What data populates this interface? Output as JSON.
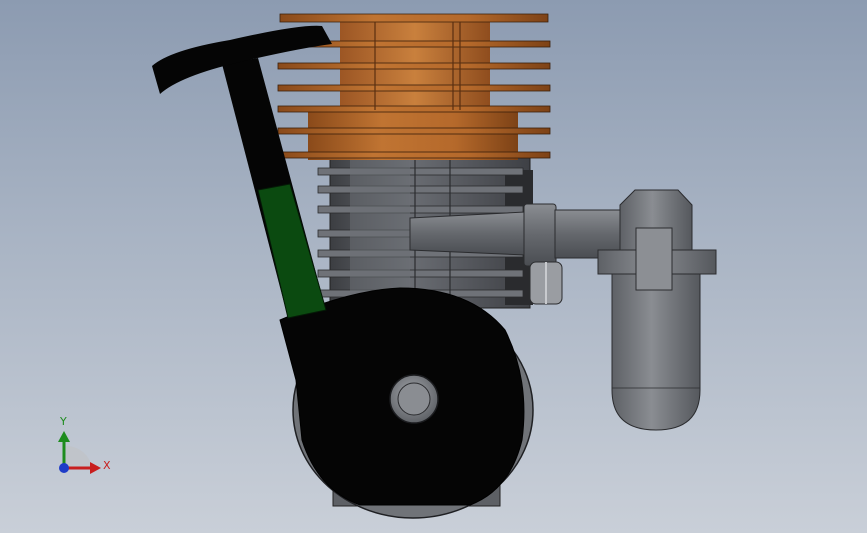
{
  "triad": {
    "x_label": "X",
    "y_label": "Y"
  },
  "colors": {
    "background_top": "#8c9bb1",
    "background_bottom": "#c9cfd8",
    "cooling_head": "#b0642a",
    "pull_handle": "#0a0a0a",
    "pull_shaft_green": "#0b4a10",
    "engine_gray": "#5a5d63",
    "axis_x": "#c81e1e",
    "axis_y": "#1e8c1e",
    "axis_z": "#1e3cc8"
  }
}
